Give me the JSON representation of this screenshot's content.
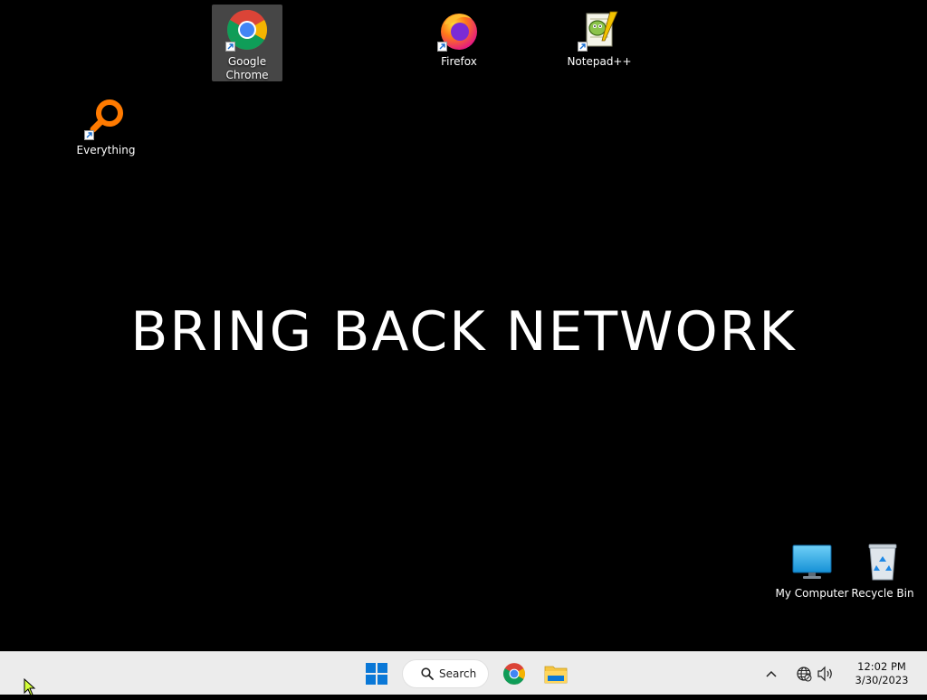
{
  "desktop": {
    "wallpaper_text": "BRING BACK NETWORK",
    "icons": [
      {
        "label": "Google Chrome",
        "icon": "chrome-icon",
        "selected": true
      },
      {
        "label": "Firefox",
        "icon": "firefox-icon",
        "selected": false
      },
      {
        "label": "Notepad++",
        "icon": "notepad-plus-plus-icon",
        "selected": false
      },
      {
        "label": "Everything",
        "icon": "everything-search-icon",
        "selected": false
      },
      {
        "label": "My Computer",
        "icon": "my-computer-icon",
        "selected": false
      },
      {
        "label": "Recycle Bin",
        "icon": "recycle-bin-icon",
        "selected": false
      }
    ]
  },
  "taskbar": {
    "start_icon": "windows-start-icon",
    "search_label": "Search",
    "apps": [
      "chrome-icon",
      "file-explorer-icon"
    ],
    "tray": {
      "chevron_icon": "show-hidden-icons-chevron",
      "network_icon": "network-globe-icon",
      "volume_icon": "volume-icon",
      "time": "12:02 PM",
      "date": "3/30/2023"
    }
  },
  "colors": {
    "desktop_bg": "#000000",
    "taskbar_bg": "#ececec",
    "windows_blue": "#0a78d7",
    "folder_yellow": "#f5c542"
  }
}
